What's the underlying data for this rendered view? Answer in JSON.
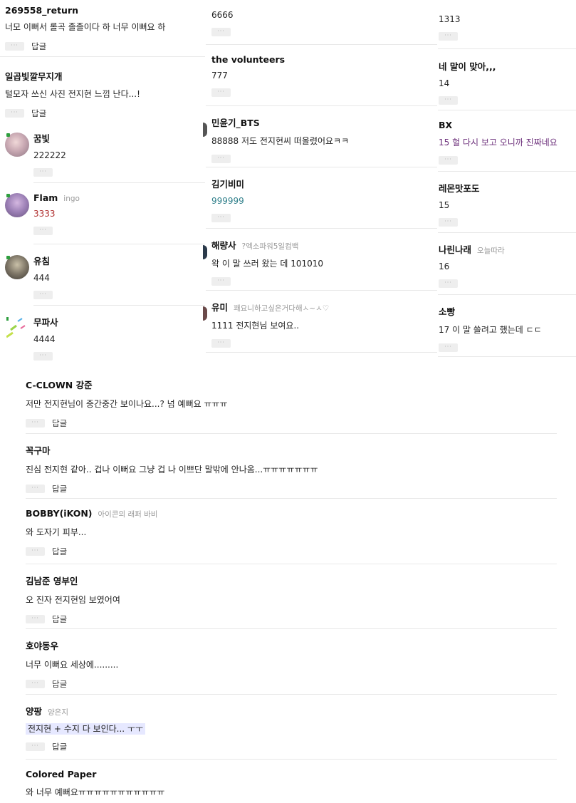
{
  "left_column": {
    "top_comments": [
      {
        "nick": "269558_return",
        "text": "너모 이뻐서 롤곡 졸졸이다 하 너무 이뻐요 하",
        "reply": "답글"
      },
      {
        "nick": "일곱빛깔무지개",
        "text": "털모자 쓰신 사진 전지현 느낌 난다...!",
        "reply": "답글"
      }
    ],
    "nested_replies": [
      {
        "nick": "꿈빛",
        "sub": "",
        "text": "222222"
      },
      {
        "nick": "Flam",
        "sub": "ingo",
        "text": "3333"
      },
      {
        "nick": "유침",
        "sub": "",
        "text": "444"
      },
      {
        "nick": "무파사",
        "sub": "",
        "text": "4444"
      }
    ]
  },
  "middle_column": {
    "top_text": "6666",
    "comments": [
      {
        "nick": "the volunteers",
        "sub": "",
        "text": "777"
      },
      {
        "nick": "민윤기_BTS",
        "sub": "",
        "text": "88888 저도 전지현씨 떠올렸어요ㅋㅋ"
      },
      {
        "nick": "김기비미",
        "sub": "",
        "text": "999999"
      },
      {
        "nick": "해량사",
        "sub": "?엑소파워5일컴백",
        "text": "왁 이 말 쓰러 왔는 데 101010"
      },
      {
        "nick": "유미",
        "sub": "꽤요니하고싶은거다해ㅅ~ㅅ♡",
        "text": "1111 전지현님 보여요.."
      }
    ]
  },
  "right_column": {
    "top_text": "1313",
    "comments": [
      {
        "nick": "네 말이 맞아,,,",
        "sub": "",
        "text": "14"
      },
      {
        "nick": "BX",
        "sub": "",
        "text": "15 헐 다시 보고 오니까 진짜네요"
      },
      {
        "nick": "레몬맛포도",
        "sub": "",
        "text": "15"
      },
      {
        "nick": "나린나래",
        "sub": "오늘따라",
        "text": "16"
      },
      {
        "nick": "소빵",
        "sub": "",
        "text": "17 이 말 쓸려고 했는데 ㄷㄷ"
      }
    ]
  },
  "bottom_comments": [
    {
      "nick": "C-CLOWN 강준",
      "sub": "",
      "text": "저만 전지현님이 중간중간 보이나요...? 넘 예뻐요 ㅠㅠㅠ",
      "reply": "답글"
    },
    {
      "nick": "꼭구마",
      "sub": "",
      "text": "진심 전지현 같아.. 겁나 이뻐요 그냥 겁 나 이쁘단 말밖에 안나옴...ㅠㅠㅠㅠㅠㅠㅠ",
      "reply": "답글"
    },
    {
      "nick": "BOBBY(iKON)",
      "sub": "아이콘의 래퍼 바비",
      "text": "와 도자기 피부...",
      "reply": "답글"
    },
    {
      "nick": "김남준 영부인",
      "sub": "",
      "text": "오 진자 전지현임 보였어여",
      "reply": "답글"
    },
    {
      "nick": "호야동우",
      "sub": "",
      "text": "너무 이뻐요 세상에.........",
      "reply": "답글"
    },
    {
      "nick": "양팡",
      "sub": "양은지",
      "text": "전지현 + 수지 다 보인다... ㅜㅜ",
      "reply": "답글"
    },
    {
      "nick": "Colored Paper",
      "sub": "",
      "text": "와 너무 예뻐요ㅠㅠㅠㅠㅠㅠㅠㅠㅠㅠㅠ",
      "reply": ""
    }
  ],
  "more_label": "···",
  "colors": {
    "highlight": "#e6e8ff",
    "divider": "#e8e8e8",
    "bx_text": "#6b2e7a",
    "number_text": "#2f7f8a",
    "red_text": "#b03030"
  }
}
